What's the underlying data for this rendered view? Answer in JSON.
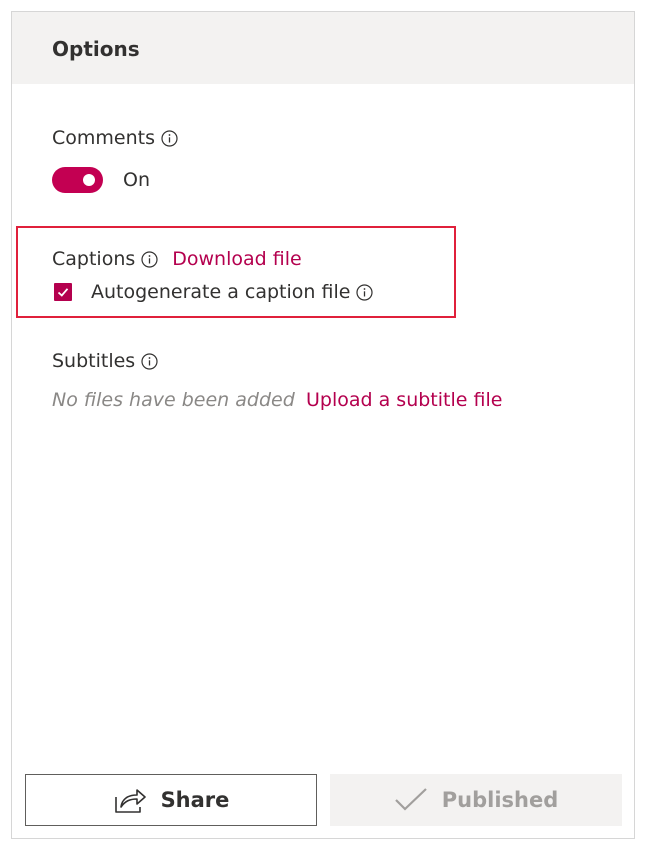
{
  "panel": {
    "title": "Options"
  },
  "comments": {
    "label": "Comments",
    "toggle_state": "On",
    "enabled": true
  },
  "captions": {
    "label": "Captions",
    "download_link": "Download file",
    "autogenerate_label": "Autogenerate a caption file",
    "autogenerate_checked": true
  },
  "subtitles": {
    "label": "Subtitles",
    "empty_text": "No files have been added",
    "upload_link": "Upload a subtitle file"
  },
  "footer": {
    "share_label": "Share",
    "published_label": "Published"
  },
  "colors": {
    "accent": "#c30052",
    "link": "#b4004e",
    "highlight": "#e0203b"
  },
  "icons": [
    "info-icon",
    "check-icon",
    "share-icon",
    "checkmark-icon"
  ]
}
